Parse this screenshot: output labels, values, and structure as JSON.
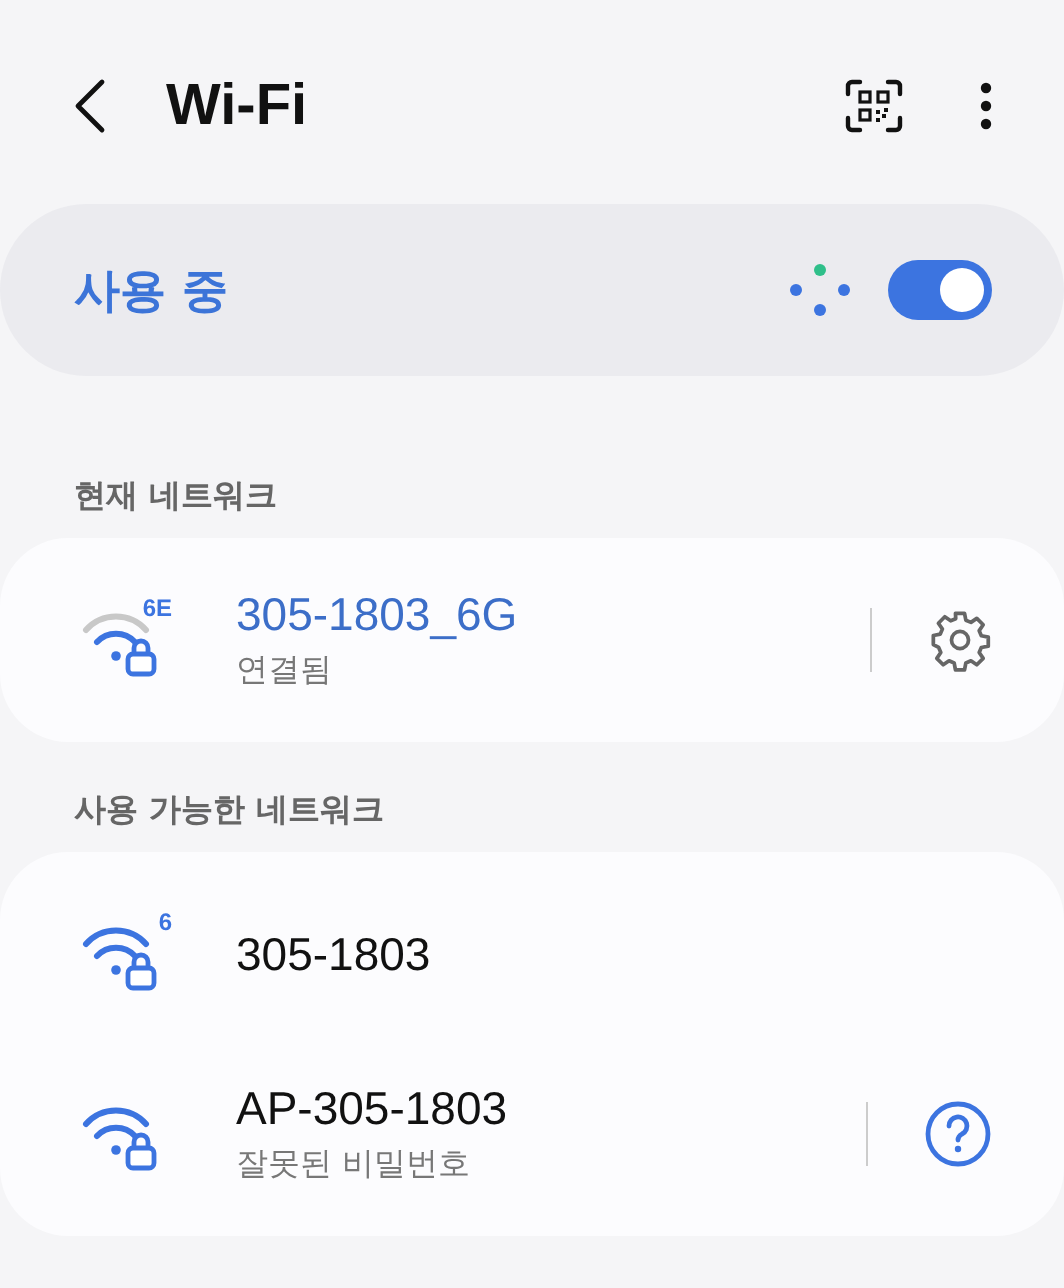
{
  "header": {
    "title": "Wi-Fi"
  },
  "master": {
    "label": "사용 중",
    "on": true
  },
  "current": {
    "heading": "현재 네트워크",
    "networks": [
      {
        "name": "305-1803_6G",
        "band": "6E",
        "status": "연결됨",
        "action": {
          "kind": "settings"
        }
      }
    ]
  },
  "available": {
    "heading": "사용 가능한 네트워크",
    "networks": [
      {
        "name": "305-1803",
        "band": "6"
      },
      {
        "name": "AP-305-1803",
        "status": "잘못된 비밀번호",
        "action": {
          "kind": "help"
        }
      }
    ]
  }
}
